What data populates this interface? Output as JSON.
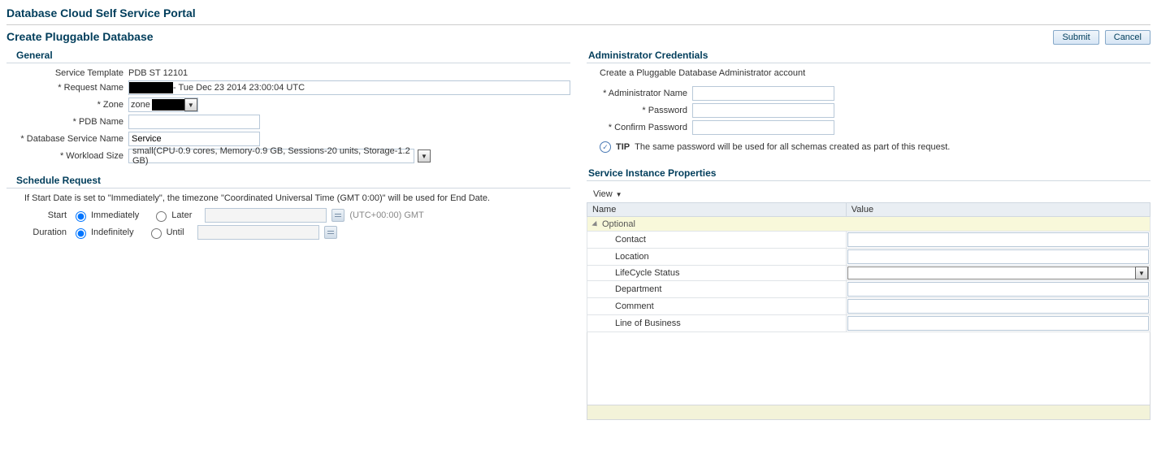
{
  "portalTitle": "Database Cloud Self Service Portal",
  "pageTitle": "Create Pluggable Database",
  "buttons": {
    "submit": "Submit",
    "cancel": "Cancel"
  },
  "general": {
    "title": "General",
    "labels": {
      "serviceTemplate": "Service Template",
      "requestName": "Request Name",
      "zone": "Zone",
      "pdbName": "PDB Name",
      "dbServiceName": "Database Service Name",
      "workloadSize": "Workload Size"
    },
    "values": {
      "serviceTemplate": "PDB ST 12101",
      "requestNameSuffix": "- Tue Dec 23 2014 23:00:04 UTC",
      "zonePrefix": "zone",
      "pdbName": "",
      "dbServiceName": "Service",
      "workloadSize": "small(CPU-0.9 cores, Memory-0.9 GB, Sessions-20 units, Storage-1.2 GB)"
    }
  },
  "schedule": {
    "title": "Schedule Request",
    "note": "If Start Date is set to \"Immediately\", the timezone \"Coordinated Universal Time (GMT 0:00)\" will be used for End Date.",
    "labels": {
      "start": "Start",
      "duration": "Duration"
    },
    "start": {
      "immediately": "Immediately",
      "later": "Later",
      "tz": "(UTC+00:00) GMT",
      "selected": "immediately"
    },
    "duration": {
      "indefinitely": "Indefinitely",
      "until": "Until",
      "selected": "indefinitely"
    }
  },
  "admin": {
    "title": "Administrator Credentials",
    "note": "Create a Pluggable Database Administrator account",
    "labels": {
      "adminName": "Administrator Name",
      "password": "Password",
      "confirm": "Confirm Password"
    },
    "values": {
      "adminName": "",
      "password": "",
      "confirm": ""
    },
    "tipLabel": "TIP",
    "tipText": "The same password will be used for all schemas created as part of this request."
  },
  "props": {
    "title": "Service Instance Properties",
    "viewLabel": "View",
    "columns": {
      "name": "Name",
      "value": "Value"
    },
    "groupLabel": "Optional",
    "rows": [
      {
        "name": "Contact",
        "type": "text"
      },
      {
        "name": "Location",
        "type": "text"
      },
      {
        "name": "LifeCycle Status",
        "type": "dropdown"
      },
      {
        "name": "Department",
        "type": "text"
      },
      {
        "name": "Comment",
        "type": "text"
      },
      {
        "name": "Line of Business",
        "type": "text"
      }
    ]
  }
}
